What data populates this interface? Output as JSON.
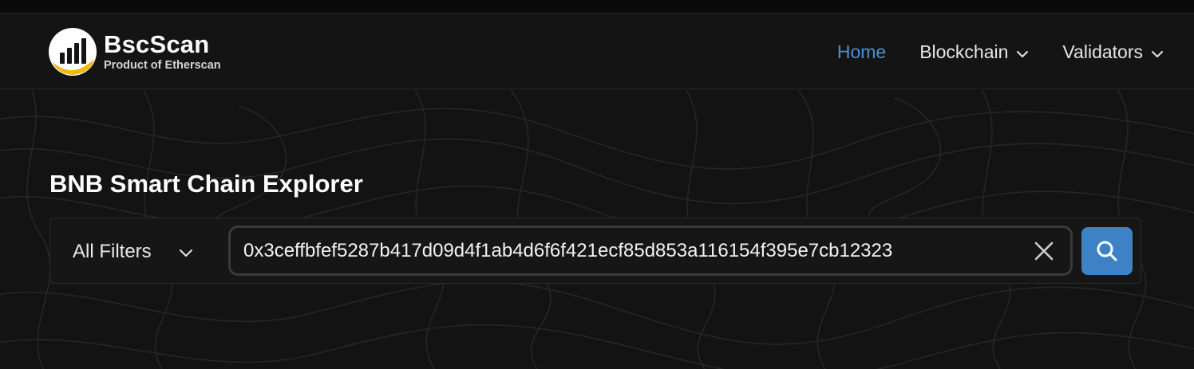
{
  "brand": {
    "name": "BscScan",
    "tagline": "Product of Etherscan",
    "logo_color": "#f0b90b"
  },
  "nav": {
    "items": [
      {
        "label": "Home",
        "active": true
      },
      {
        "label": "Blockchain",
        "dropdown": true
      },
      {
        "label": "Validators",
        "dropdown": true
      }
    ]
  },
  "hero": {
    "title": "BNB Smart Chain Explorer"
  },
  "search": {
    "filter_label": "All Filters",
    "value": "0x3ceffbfef5287b417d09d4f1ab4d6f6f421ecf85d853a116154f395e7cb12323",
    "icons": {
      "clear": "close-icon",
      "submit": "search-icon",
      "filter": "chevron-down-icon"
    }
  },
  "colors": {
    "accent": "#3d82c4",
    "nav_active": "#4f8fd1",
    "background": "#131313"
  }
}
